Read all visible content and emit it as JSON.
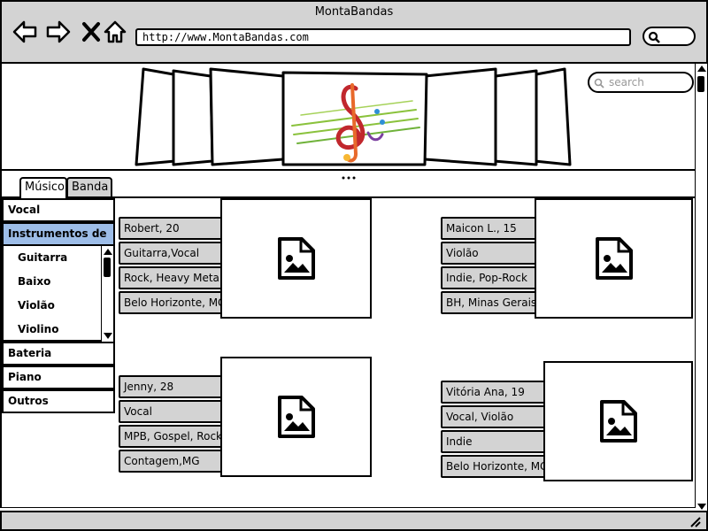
{
  "window": {
    "title": "MontaBandas"
  },
  "browser": {
    "url": "http://www.MontaBandas.com"
  },
  "page_search": {
    "placeholder": "search"
  },
  "tabs": [
    {
      "label": "Músico"
    },
    {
      "label": "Banda"
    }
  ],
  "accordion": {
    "vocal": "Vocal",
    "instrumentos": "Instrumentos de",
    "subitems": [
      "Guitarra",
      "Baixo",
      "Violão",
      "Violino"
    ],
    "bateria": "Bateria",
    "piano": "Piano",
    "outros": "Outros"
  },
  "musicians": [
    {
      "name": "Robert, 20",
      "instruments": "Guitarra,Vocal",
      "genres": "Rock, Heavy Metal",
      "city": "Belo Horizonte, MG"
    },
    {
      "name": "Maicon L., 15",
      "instruments": "Violão",
      "genres": "Indie, Pop-Rock",
      "city": "BH, Minas Gerais"
    },
    {
      "name": "Jenny, 28",
      "instruments": "Vocal",
      "genres": "MPB, Gospel, Rock",
      "city": "Contagem,MG"
    },
    {
      "name": "Vitória Ana, 19",
      "instruments": "Vocal, Violão",
      "genres": "Indie",
      "city": "Belo Horizonte, MG"
    }
  ]
}
